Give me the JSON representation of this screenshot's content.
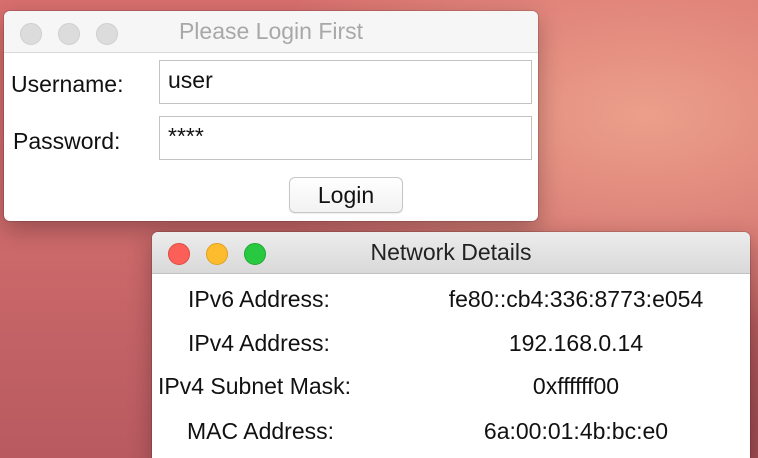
{
  "login_window": {
    "title": "Please Login First",
    "username_label": "Username:",
    "username_value": "user",
    "password_label": "Password:",
    "password_value": "****",
    "login_button": "Login"
  },
  "network_window": {
    "title": "Network Details",
    "rows": [
      {
        "label": "IPv6 Address:",
        "value": "fe80::cb4:336:8773:e054"
      },
      {
        "label": "IPv4 Address:",
        "value": "192.168.0.14"
      },
      {
        "label": "IPv4 Subnet Mask:",
        "value": "0xffffff00"
      },
      {
        "label": "MAC Address:",
        "value": "6a:00:01:4b:bc:e0"
      }
    ]
  },
  "colors": {
    "close": "#fc5f57",
    "minimize": "#fdbc2e",
    "maximize": "#28c840",
    "inactive_light": "#dcdcdc"
  }
}
